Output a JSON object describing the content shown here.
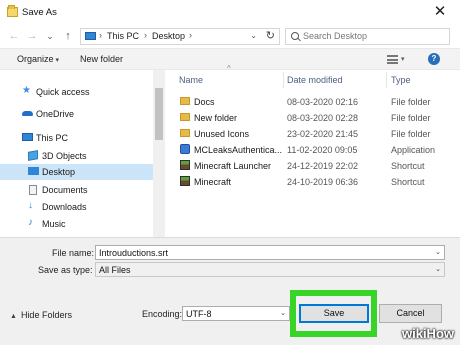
{
  "window": {
    "title": "Save As"
  },
  "nav": {
    "back": "←",
    "forward": "→",
    "history": "⌄",
    "up": "↑",
    "crumbs": [
      "This PC",
      "Desktop"
    ],
    "search_placeholder": "Search Desktop"
  },
  "toolbar": {
    "organize": "Organize",
    "new_folder": "New folder"
  },
  "sidebar": {
    "items": [
      {
        "label": "Quick access",
        "icon": "star-icon",
        "color": "#3b8ede"
      },
      {
        "label": "OneDrive",
        "icon": "cloud-icon",
        "color": "#1f70c9"
      },
      {
        "label": "This PC",
        "icon": "pc-icon",
        "color": "#2f86d6"
      },
      {
        "label": "3D Objects",
        "icon": "cube-icon",
        "color": "#4aa3e0"
      },
      {
        "label": "Desktop",
        "icon": "desktop-icon",
        "color": "#2f86d6",
        "selected": true
      },
      {
        "label": "Documents",
        "icon": "documents-icon",
        "color": "#8a8a8a"
      },
      {
        "label": "Downloads",
        "icon": "download-icon",
        "color": "#2f86d6"
      },
      {
        "label": "Music",
        "icon": "music-icon",
        "color": "#2f86d6"
      }
    ]
  },
  "files": {
    "columns": {
      "name": "Name",
      "date": "Date modified",
      "type": "Type"
    },
    "rows": [
      {
        "name": "Docs",
        "date": "08-03-2020 02:16",
        "type": "File folder",
        "icon": "folder-icon"
      },
      {
        "name": "New folder",
        "date": "08-03-2020 02:28",
        "type": "File folder",
        "icon": "folder-icon"
      },
      {
        "name": "Unused Icons",
        "date": "23-02-2020 21:45",
        "type": "File folder",
        "icon": "folder-icon"
      },
      {
        "name": "MCLeaksAuthentica...",
        "date": "11-02-2020 09:05",
        "type": "Application",
        "icon": "application-icon"
      },
      {
        "name": "Minecraft Launcher",
        "date": "24-12-2019 22:02",
        "type": "Shortcut",
        "icon": "minecraft-icon"
      },
      {
        "name": "Minecraft",
        "date": "24-10-2019 06:36",
        "type": "Shortcut",
        "icon": "minecraft-icon"
      }
    ]
  },
  "form": {
    "file_name_label": "File name:",
    "file_name_value": "Introuductions.srt",
    "save_type_label": "Save as type:",
    "save_type_value": "All Files",
    "encoding_label": "Encoding:",
    "encoding_value": "UTF-8"
  },
  "footer": {
    "hide_folders": "Hide Folders",
    "save": "Save",
    "cancel": "Cancel"
  },
  "watermark": "wikiHow",
  "colors": {
    "highlight": "#38d428",
    "selection": "#cce4f7",
    "folder": "#e8b84a",
    "header_text": "#4d6082"
  }
}
